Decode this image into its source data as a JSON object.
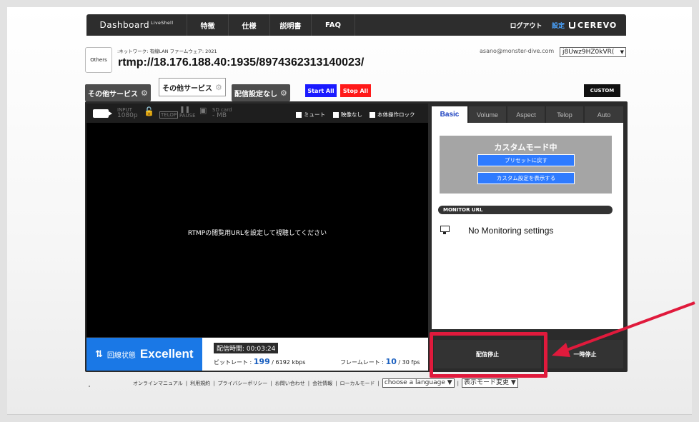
{
  "nav": {
    "brand": "Dashboard",
    "brand_sup": "LiveShell",
    "items": [
      {
        "label": "特徴"
      },
      {
        "label": "仕様"
      },
      {
        "label": "説明書"
      },
      {
        "label": "FAQ"
      }
    ],
    "logout": "ログアウト",
    "settings": "設定",
    "logo": "CEREVO"
  },
  "info": {
    "others": "Others",
    "network_line": ":ネットワーク: 有線LAN  ファームウェア: 2021",
    "rtmp_url": "rtmp://18.176.188.40:1935/8974362313140023/",
    "email": "asano@monster-dive.com",
    "stream_key": "j8Uwz9HZ0kVR("
  },
  "buttons": {
    "service1": "その他サービス",
    "service2": "その他サービス",
    "no_config": "配信設定なし",
    "start_all": "Start All",
    "stop_all": "Stop All",
    "custom": "CUSTOM"
  },
  "status_bar": {
    "input_label": "INPUT",
    "input_value": "1080p",
    "telop": "TELOP",
    "pause": "PAUSE",
    "sd_label": "SD card",
    "sd_value": "- MB",
    "mute": "ミュート",
    "no_video": "映像なし",
    "lock": "本体操作ロック"
  },
  "video": {
    "message": "RTMPの閲覧用URLを設定して視聴してください"
  },
  "tabs": [
    {
      "label": "Basic",
      "active": true
    },
    {
      "label": "Volume"
    },
    {
      "label": "Aspect"
    },
    {
      "label": "Telop"
    },
    {
      "label": "Auto"
    }
  ],
  "side": {
    "custom_title": "カスタムモード中",
    "reset_preset": "プリセットに戻す",
    "show_custom": "カスタム設定を表示する",
    "monitor_header": "MONITOR URL",
    "no_monitoring": "No Monitoring settings"
  },
  "bottom": {
    "line_label": "回線状態",
    "line_value": "Excellent",
    "time_label": "配信時間: ",
    "time_value": "00:03:24",
    "bitrate_label": "ビットレート : ",
    "bitrate_value": "199",
    "bitrate_max": " / 6192 kbps",
    "framerate_label": "フレームレート : ",
    "framerate_value": "10",
    "framerate_max": " / 30 fps",
    "stop_stream": "配信停止",
    "pause": "一時停止"
  },
  "footer": {
    "links": [
      "オンラインマニュアル",
      "利用規約",
      "プライバシーポリシー",
      "お問い合わせ",
      "会社情報",
      "ローカルモード"
    ],
    "language": "choose a language",
    "display_mode": "表示モード変更"
  },
  "colors": {
    "accent_blue": "#1a78e6",
    "start_blue": "#1a1aff",
    "stop_red": "#ff1a1a",
    "highlight_red": "#e01a3c"
  }
}
